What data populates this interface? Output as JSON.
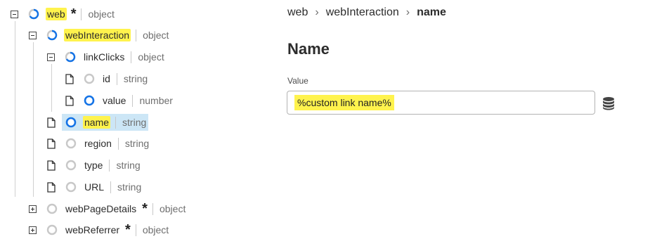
{
  "tree": {
    "nodes": [
      {
        "name": "web",
        "type": "object",
        "required": "*"
      },
      {
        "name": "webInteraction",
        "type": "object"
      },
      {
        "name": "linkClicks",
        "type": "object"
      },
      {
        "name": "id",
        "type": "string"
      },
      {
        "name": "value",
        "type": "number"
      },
      {
        "name": "name",
        "type": "string"
      },
      {
        "name": "region",
        "type": "string"
      },
      {
        "name": "type",
        "type": "string"
      },
      {
        "name": "URL",
        "type": "string"
      },
      {
        "name": "webPageDetails",
        "type": "object",
        "required": "*"
      },
      {
        "name": "webReferrer",
        "type": "object",
        "required": "*"
      }
    ]
  },
  "breadcrumb": {
    "items": [
      "web",
      "webInteraction",
      "name"
    ],
    "separator": "›"
  },
  "detail": {
    "title": "Name",
    "value_label": "Value",
    "value": "%custom link name%"
  },
  "icons": {
    "db": "database-icon",
    "doc": "document-icon",
    "expand": "expand-icon",
    "collapse": "collapse-icon",
    "status": "status-ring-icon"
  },
  "colors": {
    "accent": "#1473e6",
    "highlight": "#fff34d",
    "selection": "#cce6f6",
    "status_empty": "#c8c8c8"
  }
}
